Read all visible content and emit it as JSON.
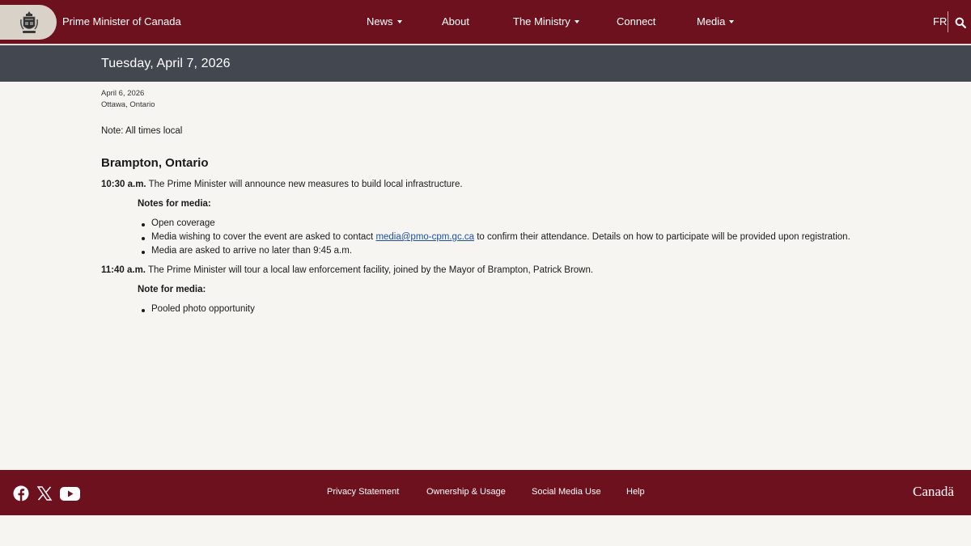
{
  "header": {
    "site_title": "Prime Minister of Canada",
    "nav": [
      {
        "label": "News",
        "has_menu": true
      },
      {
        "label": "About",
        "has_menu": false
      },
      {
        "label": "The Ministry",
        "has_menu": true
      },
      {
        "label": "Connect",
        "has_menu": false
      },
      {
        "label": "Media",
        "has_menu": true
      }
    ],
    "language_toggle": "FR",
    "search_icon": "search-icon",
    "colors": {
      "brand": "#6d111f",
      "date_band": "#434850",
      "background": "#f6f5f1",
      "link": "#1f4fa3"
    }
  },
  "page": {
    "date_title": "Tuesday, April 7, 2026",
    "published_date": "April 6, 2026",
    "location": "Ottawa, Ontario",
    "note": "Note: All times local",
    "city": "Brampton, Ontario",
    "events": [
      {
        "time": "10:30 a.m.",
        "description": "The Prime Minister will announce new measures to build local infrastructure.",
        "media_heading": "Notes for media:",
        "bullets": [
          {
            "text": "Open coverage"
          },
          {
            "before": "Media wishing to cover the event are asked to contact ",
            "link": "media@pmo-cpm.gc.ca",
            "after": " to confirm their attendance. Details on how to participate will be provided upon registration."
          },
          {
            "text": "Media are asked to arrive no later than 9:45 a.m."
          }
        ]
      },
      {
        "time": "11:40 a.m.",
        "description": "The Prime Minister will tour a local law enforcement facility, joined by the Mayor of Brampton, Patrick Brown.",
        "media_heading": "Note for media:",
        "bullets": [
          {
            "text": "Pooled photo opportunity"
          }
        ]
      }
    ]
  },
  "footer": {
    "social_icons": [
      "facebook-icon",
      "x-icon",
      "youtube-icon"
    ],
    "links": [
      "Privacy Statement",
      "Ownership & Usage",
      "Social Media Use",
      "Help"
    ],
    "wordmark": "Canadä"
  }
}
